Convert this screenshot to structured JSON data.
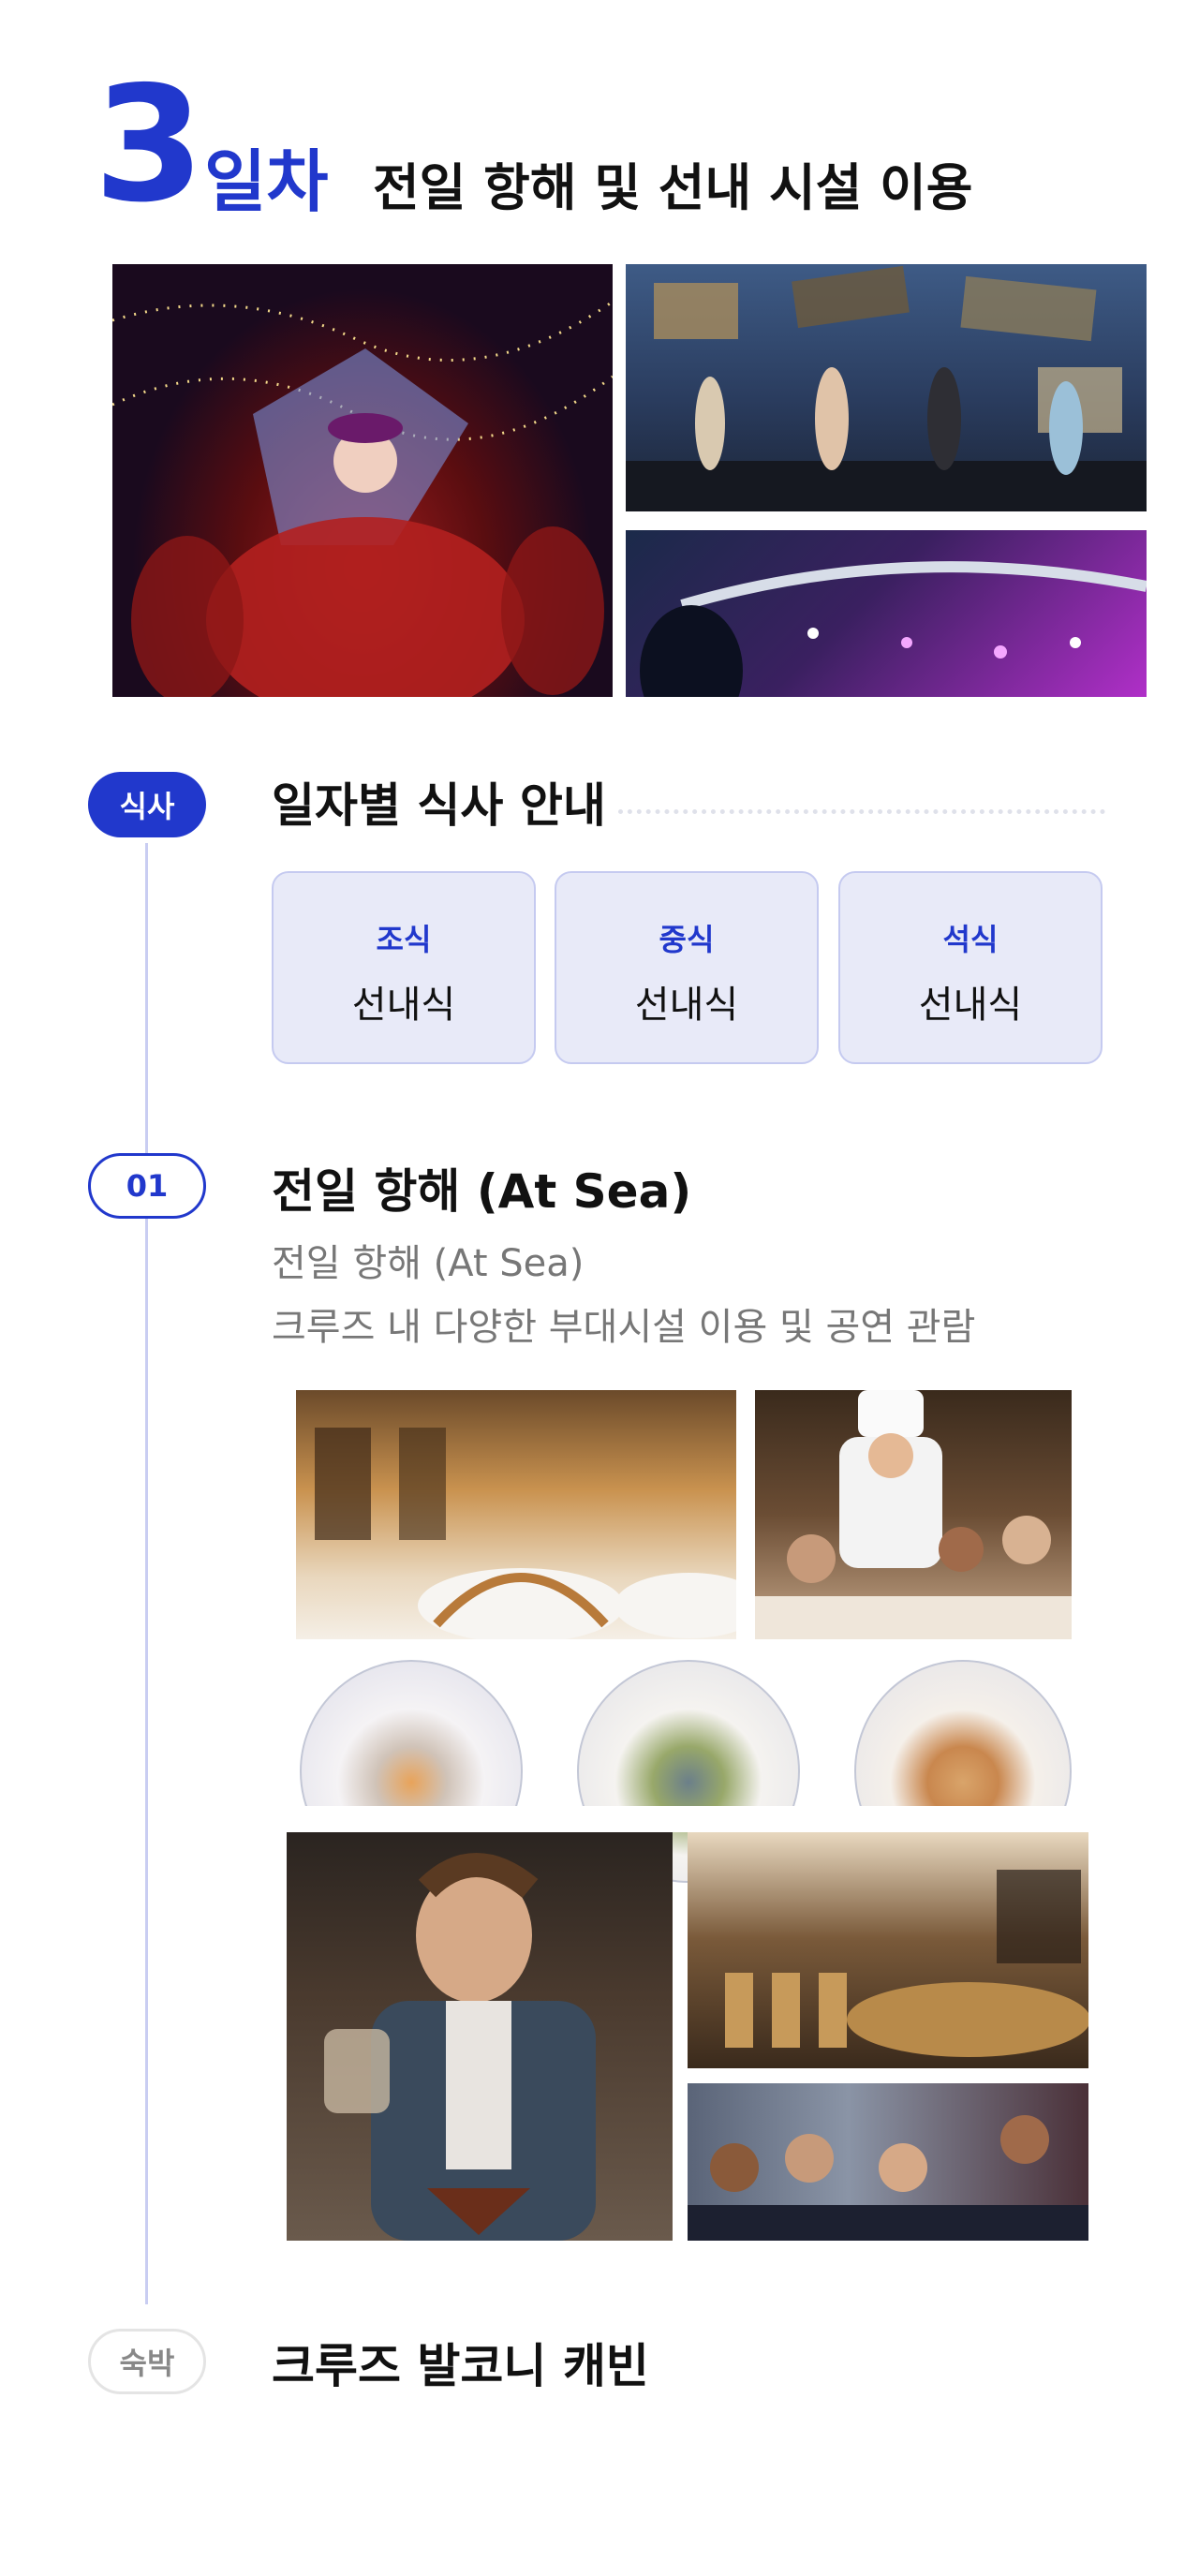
{
  "header": {
    "day_number": "3",
    "day_word": "일차",
    "subtitle": "전일 항해 및 선내 시설 이용"
  },
  "gallery_top": [
    {
      "name": "carnival-show-photo",
      "scene": "performer in red dress on illuminated stage"
    },
    {
      "name": "musical-stage-photo",
      "scene": "theatre cast singing on stage"
    },
    {
      "name": "concert-lights-photo",
      "scene": "audience watching purple-lit show"
    }
  ],
  "meal_section": {
    "badge": "식사",
    "title": "일자별 식사 안내",
    "meals": [
      {
        "label": "조식",
        "value": "선내식"
      },
      {
        "label": "중식",
        "value": "선내식"
      },
      {
        "label": "석식",
        "value": "선내식"
      }
    ]
  },
  "activity": {
    "badge": "01",
    "title": "전일 항해 (At Sea)",
    "line1": "전일 항해 (At Sea)",
    "line2": "크루즈 내 다양한 부대시설 이용 및 공연 관람"
  },
  "stay": {
    "badge": "숙박",
    "title": "크루즈 발코니 캐빈"
  },
  "colors": {
    "accent": "#2138cc",
    "card_bg": "#e8eaf8",
    "line": "#c9cdf2",
    "muted_text": "#777777"
  }
}
